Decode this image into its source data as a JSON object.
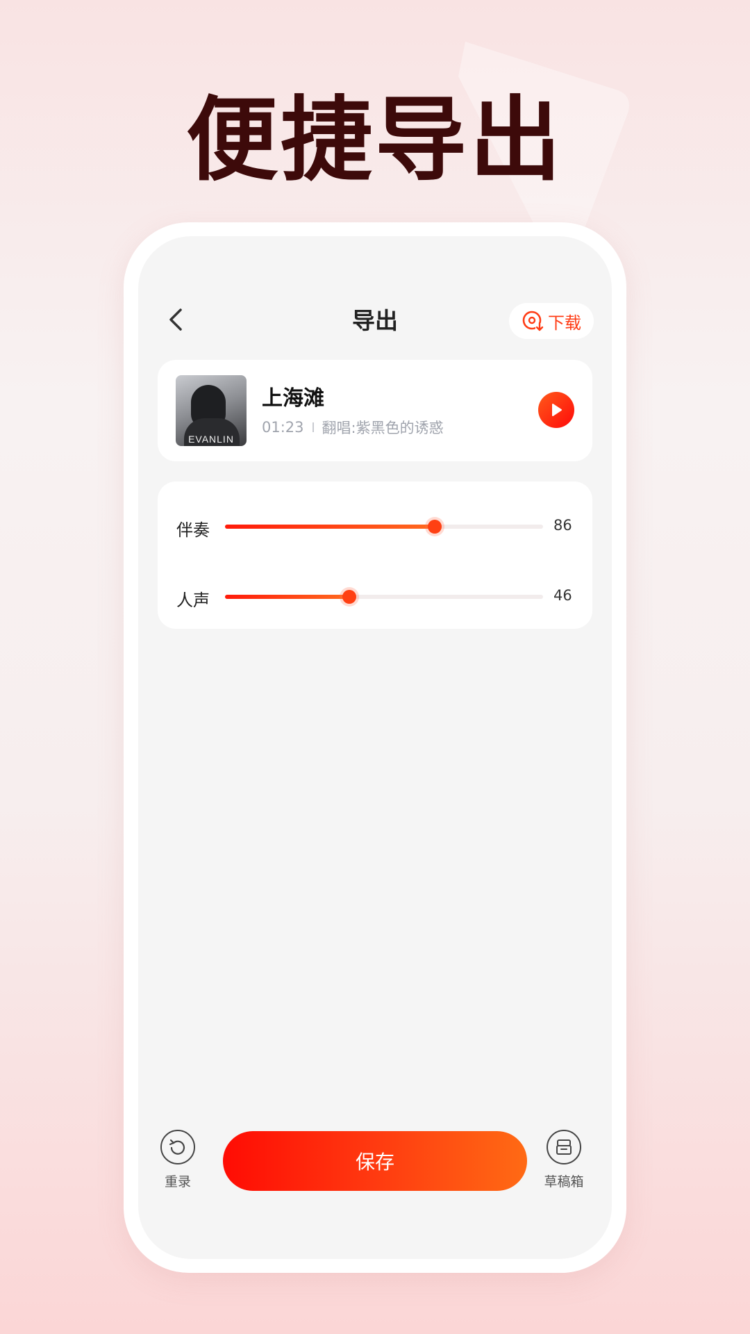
{
  "promo": {
    "headline": "便捷导出"
  },
  "header": {
    "title": "导出",
    "download_label": "下载"
  },
  "song": {
    "name": "上海滩",
    "duration": "01:23",
    "cover_by": "翻唱:紫黑色的诱惑",
    "cover_caption": "EVANLIN"
  },
  "mix": [
    {
      "label": "伴奏",
      "value": 86,
      "value_text": "86",
      "fraction": 0.66
    },
    {
      "label": "人声",
      "value": 46,
      "value_text": "46",
      "fraction": 0.39
    }
  ],
  "bottom": {
    "retake_label": "重录",
    "save_label": "保存",
    "drafts_label": "草稿箱"
  },
  "colors": {
    "accent": "#ff3b14",
    "headline": "#3d0a0a",
    "card": "#ffffff",
    "screen": "#f5f5f5"
  }
}
